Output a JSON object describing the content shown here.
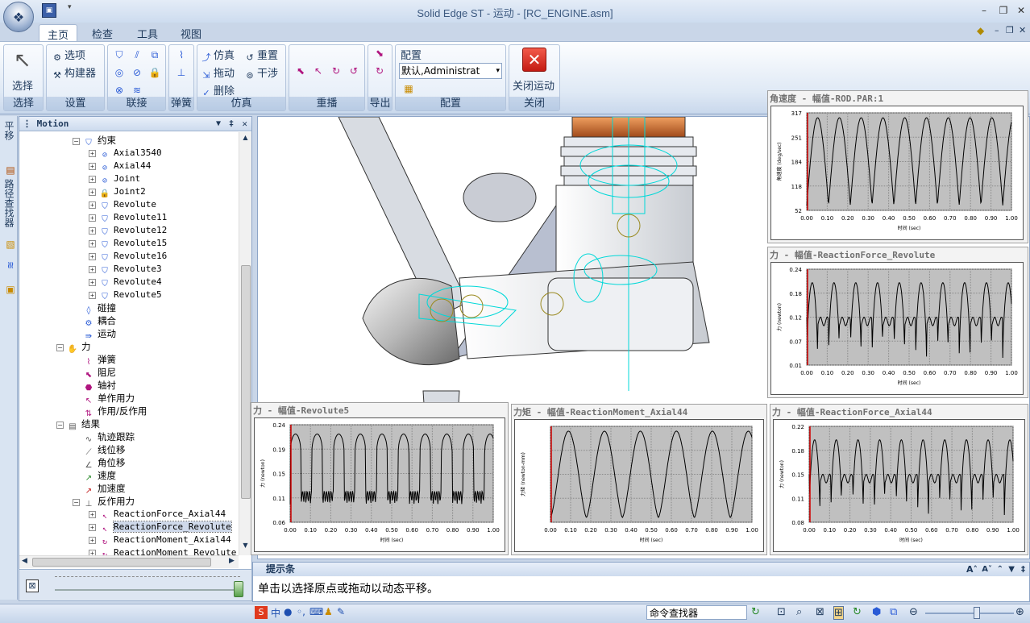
{
  "window": {
    "title": "Solid Edge ST - 运动 - [RC_ENGINE.asm]"
  },
  "tabs": [
    "主页",
    "检查",
    "工具",
    "视图"
  ],
  "ribbon": {
    "select_label": "选择",
    "groups": [
      {
        "name": "选择"
      },
      {
        "name": "设置"
      },
      {
        "name": "联接"
      },
      {
        "name": "弹簧"
      },
      {
        "name": "仿真"
      },
      {
        "name": "重播"
      },
      {
        "name": "导出"
      },
      {
        "name": "配置"
      },
      {
        "name": "关闭"
      }
    ],
    "settings": {
      "options": "选项",
      "builder": "构建器"
    },
    "simulate": {
      "simulate": "仿真",
      "reset": "重置",
      "drag": "拖动",
      "interfere": "干涉",
      "delete": "删除"
    },
    "config": {
      "label": "配置",
      "value": "默认,Administrat"
    },
    "close_motion": "关闭运动"
  },
  "left_tabs": [
    "平移",
    "路径查找器"
  ],
  "motion_panel": {
    "title": "Motion",
    "tree": [
      {
        "label": "约束",
        "indent": 1,
        "expand": "−",
        "icon": "constraint-icon",
        "mono": false
      },
      {
        "label": "Axial3540",
        "indent": 2,
        "expand": "+",
        "icon": "axial-icon",
        "mono": true
      },
      {
        "label": "Axial44",
        "indent": 2,
        "expand": "+",
        "icon": "axial-icon",
        "mono": true
      },
      {
        "label": "Joint",
        "indent": 2,
        "expand": "+",
        "icon": "joint-icon",
        "mono": true
      },
      {
        "label": "Joint2",
        "indent": 2,
        "expand": "+",
        "icon": "lock-joint-icon",
        "mono": true
      },
      {
        "label": "Revolute",
        "indent": 2,
        "expand": "+",
        "icon": "revolute-icon",
        "mono": true
      },
      {
        "label": "Revolute11",
        "indent": 2,
        "expand": "+",
        "icon": "revolute-icon",
        "mono": true
      },
      {
        "label": "Revolute12",
        "indent": 2,
        "expand": "+",
        "icon": "revolute-icon",
        "mono": true
      },
      {
        "label": "Revolute15",
        "indent": 2,
        "expand": "+",
        "icon": "revolute-icon",
        "mono": true
      },
      {
        "label": "Revolute16",
        "indent": 2,
        "expand": "+",
        "icon": "revolute-icon",
        "mono": true
      },
      {
        "label": "Revolute3",
        "indent": 2,
        "expand": "+",
        "icon": "revolute-icon",
        "mono": true
      },
      {
        "label": "Revolute4",
        "indent": 2,
        "expand": "+",
        "icon": "revolute-icon",
        "mono": true
      },
      {
        "label": "Revolute5",
        "indent": 2,
        "expand": "+",
        "icon": "revolute-icon",
        "mono": true
      },
      {
        "label": "碰撞",
        "indent": 1,
        "expand": "",
        "icon": "collision-icon",
        "mono": false
      },
      {
        "label": "耦合",
        "indent": 1,
        "expand": "",
        "icon": "coupler-icon",
        "mono": false
      },
      {
        "label": "运动",
        "indent": 1,
        "expand": "",
        "icon": "motion-icon",
        "mono": false
      },
      {
        "label": "力",
        "indent": 0,
        "expand": "−",
        "icon": "force-folder-icon",
        "mono": false
      },
      {
        "label": "弹簧",
        "indent": 1,
        "expand": "",
        "icon": "spring-icon",
        "mono": false
      },
      {
        "label": "阻尼",
        "indent": 1,
        "expand": "",
        "icon": "damper-icon",
        "mono": false
      },
      {
        "label": "轴衬",
        "indent": 1,
        "expand": "",
        "icon": "bushing-icon",
        "mono": false
      },
      {
        "label": "单作用力",
        "indent": 1,
        "expand": "",
        "icon": "single-force-icon",
        "mono": false
      },
      {
        "label": "作用/反作用",
        "indent": 1,
        "expand": "",
        "icon": "action-reaction-icon",
        "mono": false
      },
      {
        "label": "结果",
        "indent": 0,
        "expand": "−",
        "icon": "results-icon",
        "mono": false
      },
      {
        "label": "轨迹跟踪",
        "indent": 1,
        "expand": "",
        "icon": "trace-icon",
        "mono": false
      },
      {
        "label": "线位移",
        "indent": 1,
        "expand": "",
        "icon": "linear-disp-icon",
        "mono": false
      },
      {
        "label": "角位移",
        "indent": 1,
        "expand": "",
        "icon": "angular-disp-icon",
        "mono": false
      },
      {
        "label": "速度",
        "indent": 1,
        "expand": "",
        "icon": "velocity-icon",
        "mono": false
      },
      {
        "label": "加速度",
        "indent": 1,
        "expand": "",
        "icon": "acceleration-icon",
        "mono": false
      },
      {
        "label": "反作用力",
        "indent": 1,
        "expand": "−",
        "icon": "reaction-force-icon",
        "mono": false
      },
      {
        "label": "ReactionForce_Axial44",
        "indent": 2,
        "expand": "+",
        "icon": "force-icon",
        "mono": true
      },
      {
        "label": "ReactionForce_Revolute",
        "indent": 2,
        "expand": "+",
        "icon": "force-icon",
        "mono": true,
        "selected": true
      },
      {
        "label": "ReactionMoment_Axial44",
        "indent": 2,
        "expand": "+",
        "icon": "moment-icon",
        "mono": true
      },
      {
        "label": "ReactionMoment_Revolute",
        "indent": 2,
        "expand": "+",
        "icon": "moment-icon",
        "mono": true
      }
    ]
  },
  "plots": [
    {
      "title": "角速度 - 幅值-ROD.PAR:1",
      "yticks": [
        "317",
        "251",
        "184",
        "118",
        "52"
      ],
      "ylabel": "角速度 (deg/sec)",
      "xticks": [
        "0.00",
        "0.10",
        "0.20",
        "0.30",
        "0.40",
        "0.50",
        "0.60",
        "0.70",
        "0.80",
        "0.90",
        "1.00"
      ],
      "xlabel": "时间 (sec)"
    },
    {
      "title": "力 - 幅值-ReactionForce_Revolute",
      "yticks": [
        "0.24",
        "0.18",
        "0.12",
        "0.07",
        "0.01"
      ],
      "ylabel": "力 (newton)",
      "xticks": [
        "0.00",
        "0.10",
        "0.20",
        "0.30",
        "0.40",
        "0.50",
        "0.60",
        "0.70",
        "0.80",
        "0.90",
        "1.00"
      ],
      "xlabel": "时间 (sec)"
    },
    {
      "title": "力 - 幅值-Revolute5",
      "yticks": [
        "0.24",
        "0.19",
        "0.15",
        "0.11",
        "0.06"
      ],
      "ylabel": "力 (newton)",
      "xticks": [
        "0.00",
        "0.10",
        "0.20",
        "0.30",
        "0.40",
        "0.50",
        "0.60",
        "0.70",
        "0.80",
        "0.90",
        "1.00"
      ],
      "xlabel": "时间 (sec)"
    },
    {
      "title": "力矩 - 幅值-ReactionMoment_Axial44",
      "yticks": [
        "",
        "",
        "",
        "",
        ""
      ],
      "ylabel": "力矩 (newton-mm)",
      "xticks": [
        "0.00",
        "0.10",
        "0.20",
        "0.30",
        "0.40",
        "0.50",
        "0.60",
        "0.70",
        "0.80",
        "0.90",
        "1.00"
      ],
      "xlabel": "时间 (sec)"
    },
    {
      "title": "力 - 幅值-ReactionForce_Axial44",
      "yticks": [
        "0.22",
        "0.18",
        "0.15",
        "0.11",
        "0.08"
      ],
      "ylabel": "力 (newton)",
      "xticks": [
        "0.00",
        "0.10",
        "0.20",
        "0.30",
        "0.40",
        "0.50",
        "0.60",
        "0.70",
        "0.80",
        "0.90",
        "1.00"
      ],
      "xlabel": "时间 (sec)"
    }
  ],
  "prompt": {
    "title": "提示条",
    "text": "单击以选择原点或拖动以动态平移。"
  },
  "status": {
    "command_finder": "命令查找器"
  }
}
